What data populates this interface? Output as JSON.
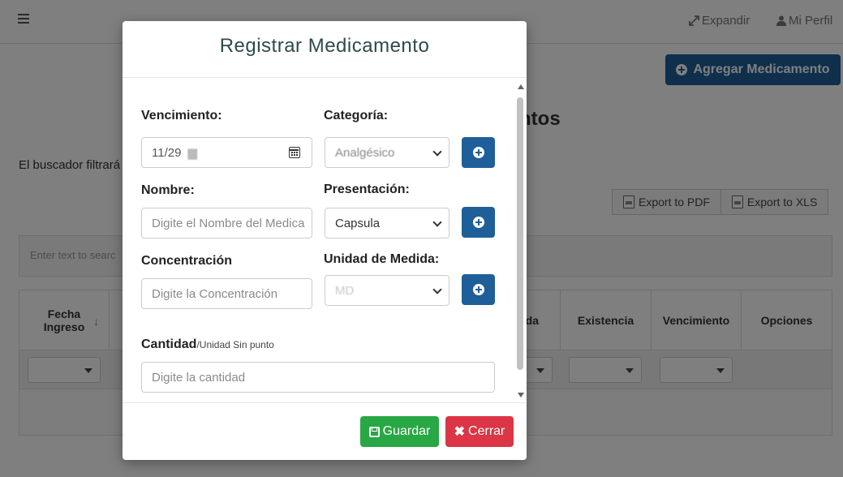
{
  "topbar": {
    "expand_label": "Expandir",
    "profile_label": "Mi Perfil"
  },
  "page": {
    "add_button_label": "Agregar Medicamento",
    "title_fragment": "ntos",
    "search_text_fragment": "El buscador filtrará",
    "export_pdf_label": "Export to PDF",
    "export_xls_label": "Export to XLS",
    "grid_search_placeholder": "Enter text to searc",
    "columns": [
      {
        "label": "Fecha\nIngreso"
      },
      {
        "label": "da"
      },
      {
        "label": "Existencia"
      },
      {
        "label": "Vencimiento"
      },
      {
        "label": "Opciones"
      }
    ]
  },
  "modal": {
    "title": "Registrar Medicamento",
    "vencimiento": {
      "label": "Vencimiento:",
      "value": "11/29"
    },
    "categoria": {
      "label": "Categoría:",
      "value": "Analgésico"
    },
    "nombre": {
      "label": "Nombre:",
      "placeholder": "Digite el Nombre del Medica"
    },
    "presentacion": {
      "label": "Presentación:",
      "value": "Capsula"
    },
    "concentracion": {
      "label": "Concentración",
      "placeholder": "Digite la Concentración"
    },
    "unidad": {
      "label": "Unidad de Medida:",
      "value": "MD"
    },
    "cantidad": {
      "label": "Cantidad",
      "sublabel": "/Unidad Sin punto",
      "placeholder": "Digite la cantidad"
    },
    "save_label": "Guardar",
    "close_label": "Cerrar"
  },
  "colors": {
    "primary": "#1f5f99",
    "success": "#28a745",
    "danger": "#dc3545"
  }
}
